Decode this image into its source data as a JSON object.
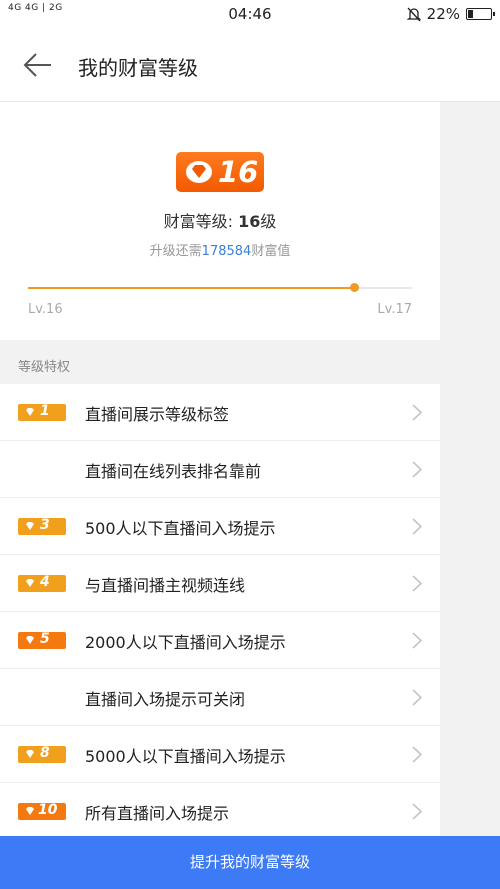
{
  "status_bar": {
    "network_top": "4G 4G | 2G",
    "time": "04:46",
    "battery": "22%",
    "battery_level": 0.22
  },
  "header": {
    "title": "我的财富等级",
    "back_icon": "arrow-left-icon"
  },
  "wealth": {
    "badge_level": "16",
    "level_label": "财富等级: ",
    "level_value": "16",
    "level_suffix": "级",
    "need_prefix": "升级还需",
    "need_value": "178584",
    "need_suffix": "财富值",
    "progress": 0.85,
    "from_label": "Lv.16",
    "to_label": "Lv.17"
  },
  "privileges": {
    "title": "等级特权",
    "items": [
      {
        "level": "1",
        "text": "直播间展示等级标签"
      },
      {
        "level": "",
        "text": "直播间在线列表排名靠前"
      },
      {
        "level": "3",
        "text": "500人以下直播间入场提示"
      },
      {
        "level": "4",
        "text": "与直播间播主视频连线"
      },
      {
        "level": "5",
        "text": "2000人以下直播间入场提示"
      },
      {
        "level": "",
        "text": "直播间入场提示可关闭"
      },
      {
        "level": "8",
        "text": "5000人以下直播间入场提示"
      },
      {
        "level": "10",
        "text": "所有直播间入场提示"
      }
    ]
  },
  "bottom_button": {
    "label": "提升我的财富等级"
  },
  "colors": {
    "accent": "#3d7af5",
    "tag": "#f0a01c",
    "tag_orange": "#f47a0f",
    "progress": "#f09a1f"
  }
}
